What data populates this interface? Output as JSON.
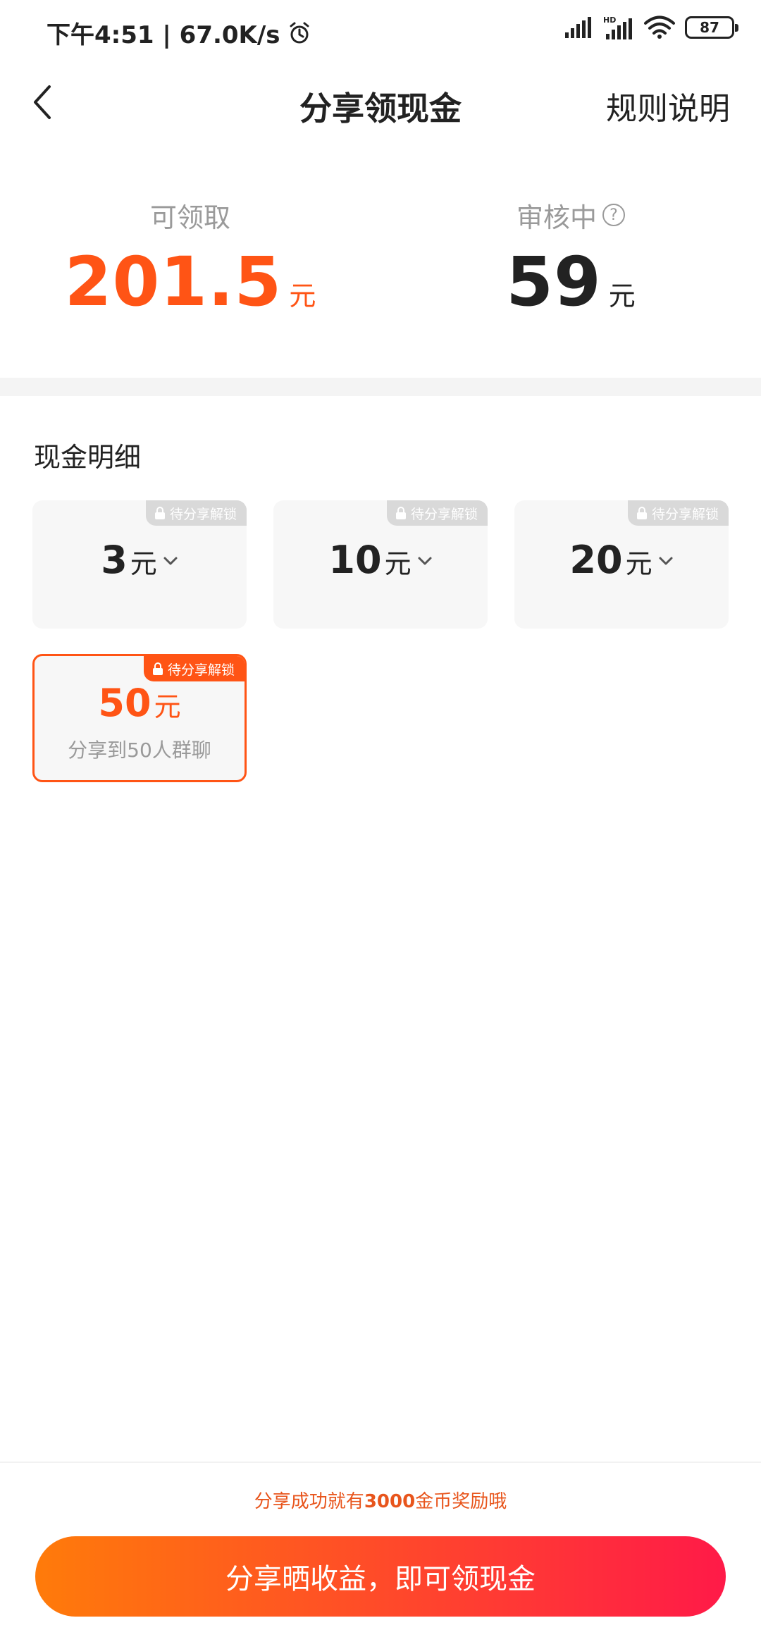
{
  "status_bar": {
    "time": "下午4:51 | 67.0K/s",
    "battery": "87",
    "icons": [
      "alarm-icon",
      "signal-icon",
      "hd-signal-icon",
      "wifi-icon",
      "battery-icon"
    ]
  },
  "nav": {
    "title": "分享领现金",
    "rules": "规则说明",
    "back_icon": "chevron-left-icon"
  },
  "summary": {
    "available": {
      "label": "可领取",
      "value": "201.5",
      "unit": "元"
    },
    "pending": {
      "label": "审核中",
      "value": "59",
      "unit": "元",
      "help_icon": "?"
    }
  },
  "section": {
    "title": "现金明细"
  },
  "cards": [
    {
      "amount": "3",
      "unit": "元",
      "tag": "待分享解锁",
      "expanded": false
    },
    {
      "amount": "10",
      "unit": "元",
      "tag": "待分享解锁",
      "expanded": false
    },
    {
      "amount": "20",
      "unit": "元",
      "tag": "待分享解锁",
      "expanded": false
    },
    {
      "amount": "50",
      "unit": "元",
      "tag": "待分享解锁",
      "desc": "分享到50人群聊",
      "active": true
    }
  ],
  "bottom": {
    "hint_prefix": "分享成功就有",
    "hint_number": "3000",
    "hint_suffix": "金币奖励哦",
    "cta": "分享晒收益，即可领现金"
  },
  "colors": {
    "accent": "#ff5415",
    "cta_start": "#ff7b0a",
    "cta_end": "#ff1a48",
    "muted": "#9a9a9a"
  }
}
